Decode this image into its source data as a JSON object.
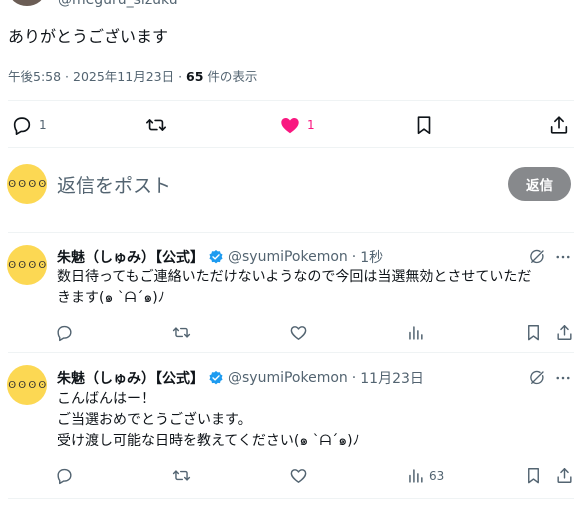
{
  "main_post": {
    "handle": "@meguru_sizuku",
    "text": "ありがとうございます",
    "time": "午後5:58 · 2025年11月23日 · ",
    "views_count": "65",
    "views_label": " 件の表示",
    "replies": "1",
    "likes": "1"
  },
  "composer": {
    "placeholder": "返信をポスト",
    "reply_button": "返信",
    "avatar_face": "ʘ ʘ ʘ ʘ"
  },
  "replies": [
    {
      "name": "朱魅（しゅみ）【公式】",
      "handle": "@syumiPokemon",
      "sep": "·",
      "time": "1秒",
      "avatar_face": "ʘ ʘ ʘ ʘ",
      "lines": [
        "数日待ってもご連絡いただけないようなので今回は当選無効とさせていただ",
        "きます(๑ `ᗩ´๑)ﾉ"
      ],
      "views": ""
    },
    {
      "name": "朱魅（しゅみ）【公式】",
      "handle": "@syumiPokemon",
      "sep": "·",
      "time": "11月23日",
      "avatar_face": "ʘ ʘ ʘ ʘ",
      "lines": [
        "こんばんはー！",
        "ご当選おめでとうございます。",
        "受け渡し可能な日時を教えてください(๑ `ᗩ´๑)ﾉ"
      ],
      "views": "63"
    }
  ],
  "colors": {
    "like_active": "#f91880",
    "verified": "#1d9bf0",
    "muted": "#536471",
    "reply_button_bg": "#87898c"
  }
}
